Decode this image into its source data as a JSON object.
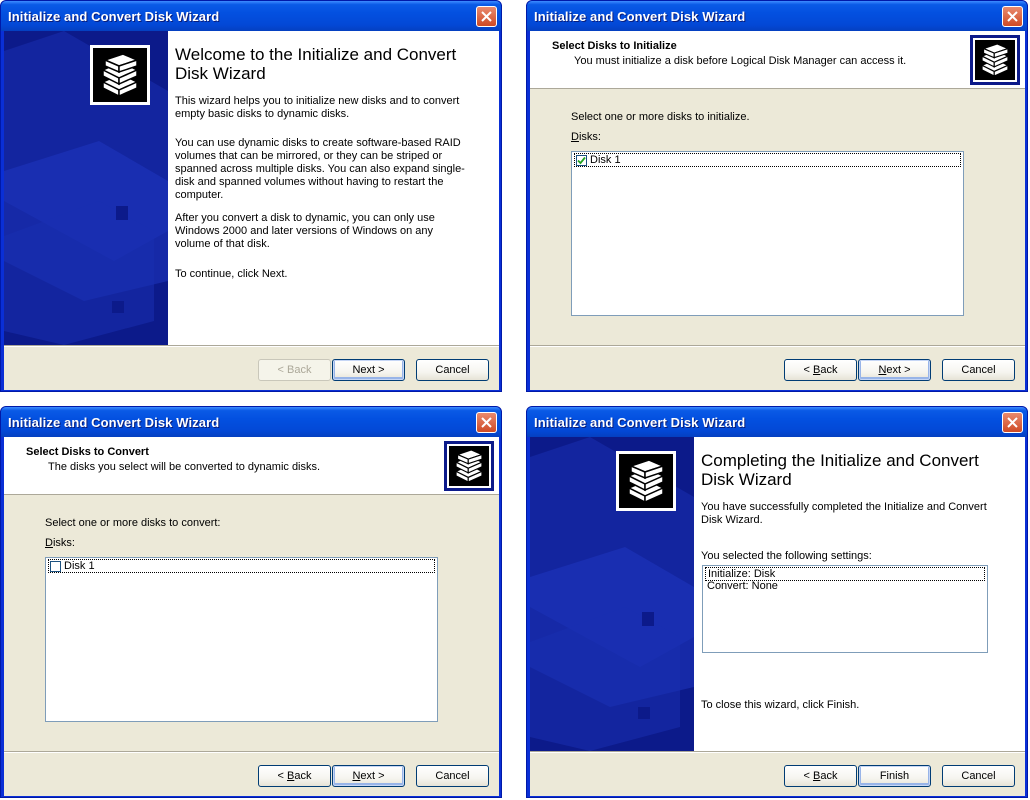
{
  "app_title": "Initialize and Convert Disk Wizard",
  "buttons": {
    "back": "< Back",
    "next": "Next >",
    "cancel": "Cancel",
    "finish": "Finish"
  },
  "welcome": {
    "title": "Welcome to the Initialize and Convert Disk Wizard",
    "paragraphs": [
      "This wizard helps you to initialize new disks and to convert empty basic disks to dynamic disks.",
      "You can use dynamic disks to create software-based RAID volumes that can be mirrored, or they can be striped or spanned across multiple disks. You can also expand single-disk and spanned volumes without having to restart the computer.",
      "After you convert a disk to dynamic, you can only use Windows 2000 and later versions of Windows on any volume of that disk.",
      "To continue, click Next."
    ]
  },
  "init_page": {
    "title": "Select Disks to Initialize",
    "subtitle": "You must initialize a disk before Logical Disk Manager can access it.",
    "instruction": "Select one or more disks to initialize.",
    "disks_label": "Disks:",
    "disks": [
      {
        "name": "Disk 1",
        "checked": true
      }
    ]
  },
  "convert_page": {
    "title": "Select Disks to Convert",
    "subtitle": "The disks you select will be converted to dynamic disks.",
    "instruction": "Select one or more disks to convert:",
    "disks_label": "Disks:",
    "disks": [
      {
        "name": "Disk 1",
        "checked": false
      }
    ]
  },
  "complete": {
    "title": "Completing the Initialize and Convert Disk Wizard",
    "success": "You have successfully completed the Initialize and Convert Disk Wizard.",
    "settings_label": "You selected the following settings:",
    "settings": [
      "Initialize: Disk",
      "Convert: None"
    ],
    "close_hint": "To close this wizard, click Finish."
  },
  "colors": {
    "title_bar": "#0350e0",
    "dialog_bg": "#ece9d8",
    "banner": "#0c1a8a",
    "close_button": "#cf4a25"
  },
  "icons": {
    "close": "close-icon",
    "disk_stack": "disk-stack-icon",
    "checkbox_check": "check-icon"
  }
}
